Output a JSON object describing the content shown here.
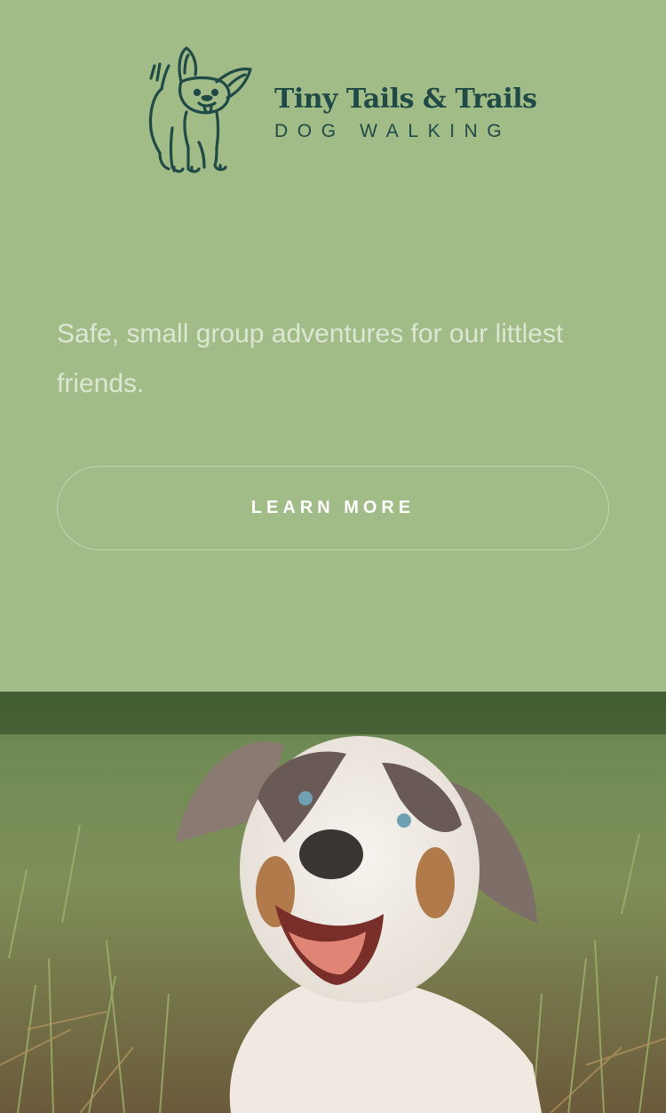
{
  "header": {
    "logo_icon": "dog-icon",
    "brand_name": "Tiny Tails & Trails",
    "brand_subtitle": "DOG WALKING",
    "brand_color": "#1f4a45"
  },
  "hero": {
    "tagline": "Safe, small group adventures for our littlest friends.",
    "cta_label": "LEARN MORE",
    "background_color": "#a2bc88"
  },
  "photo": {
    "subject": "puppy-in-grass"
  }
}
